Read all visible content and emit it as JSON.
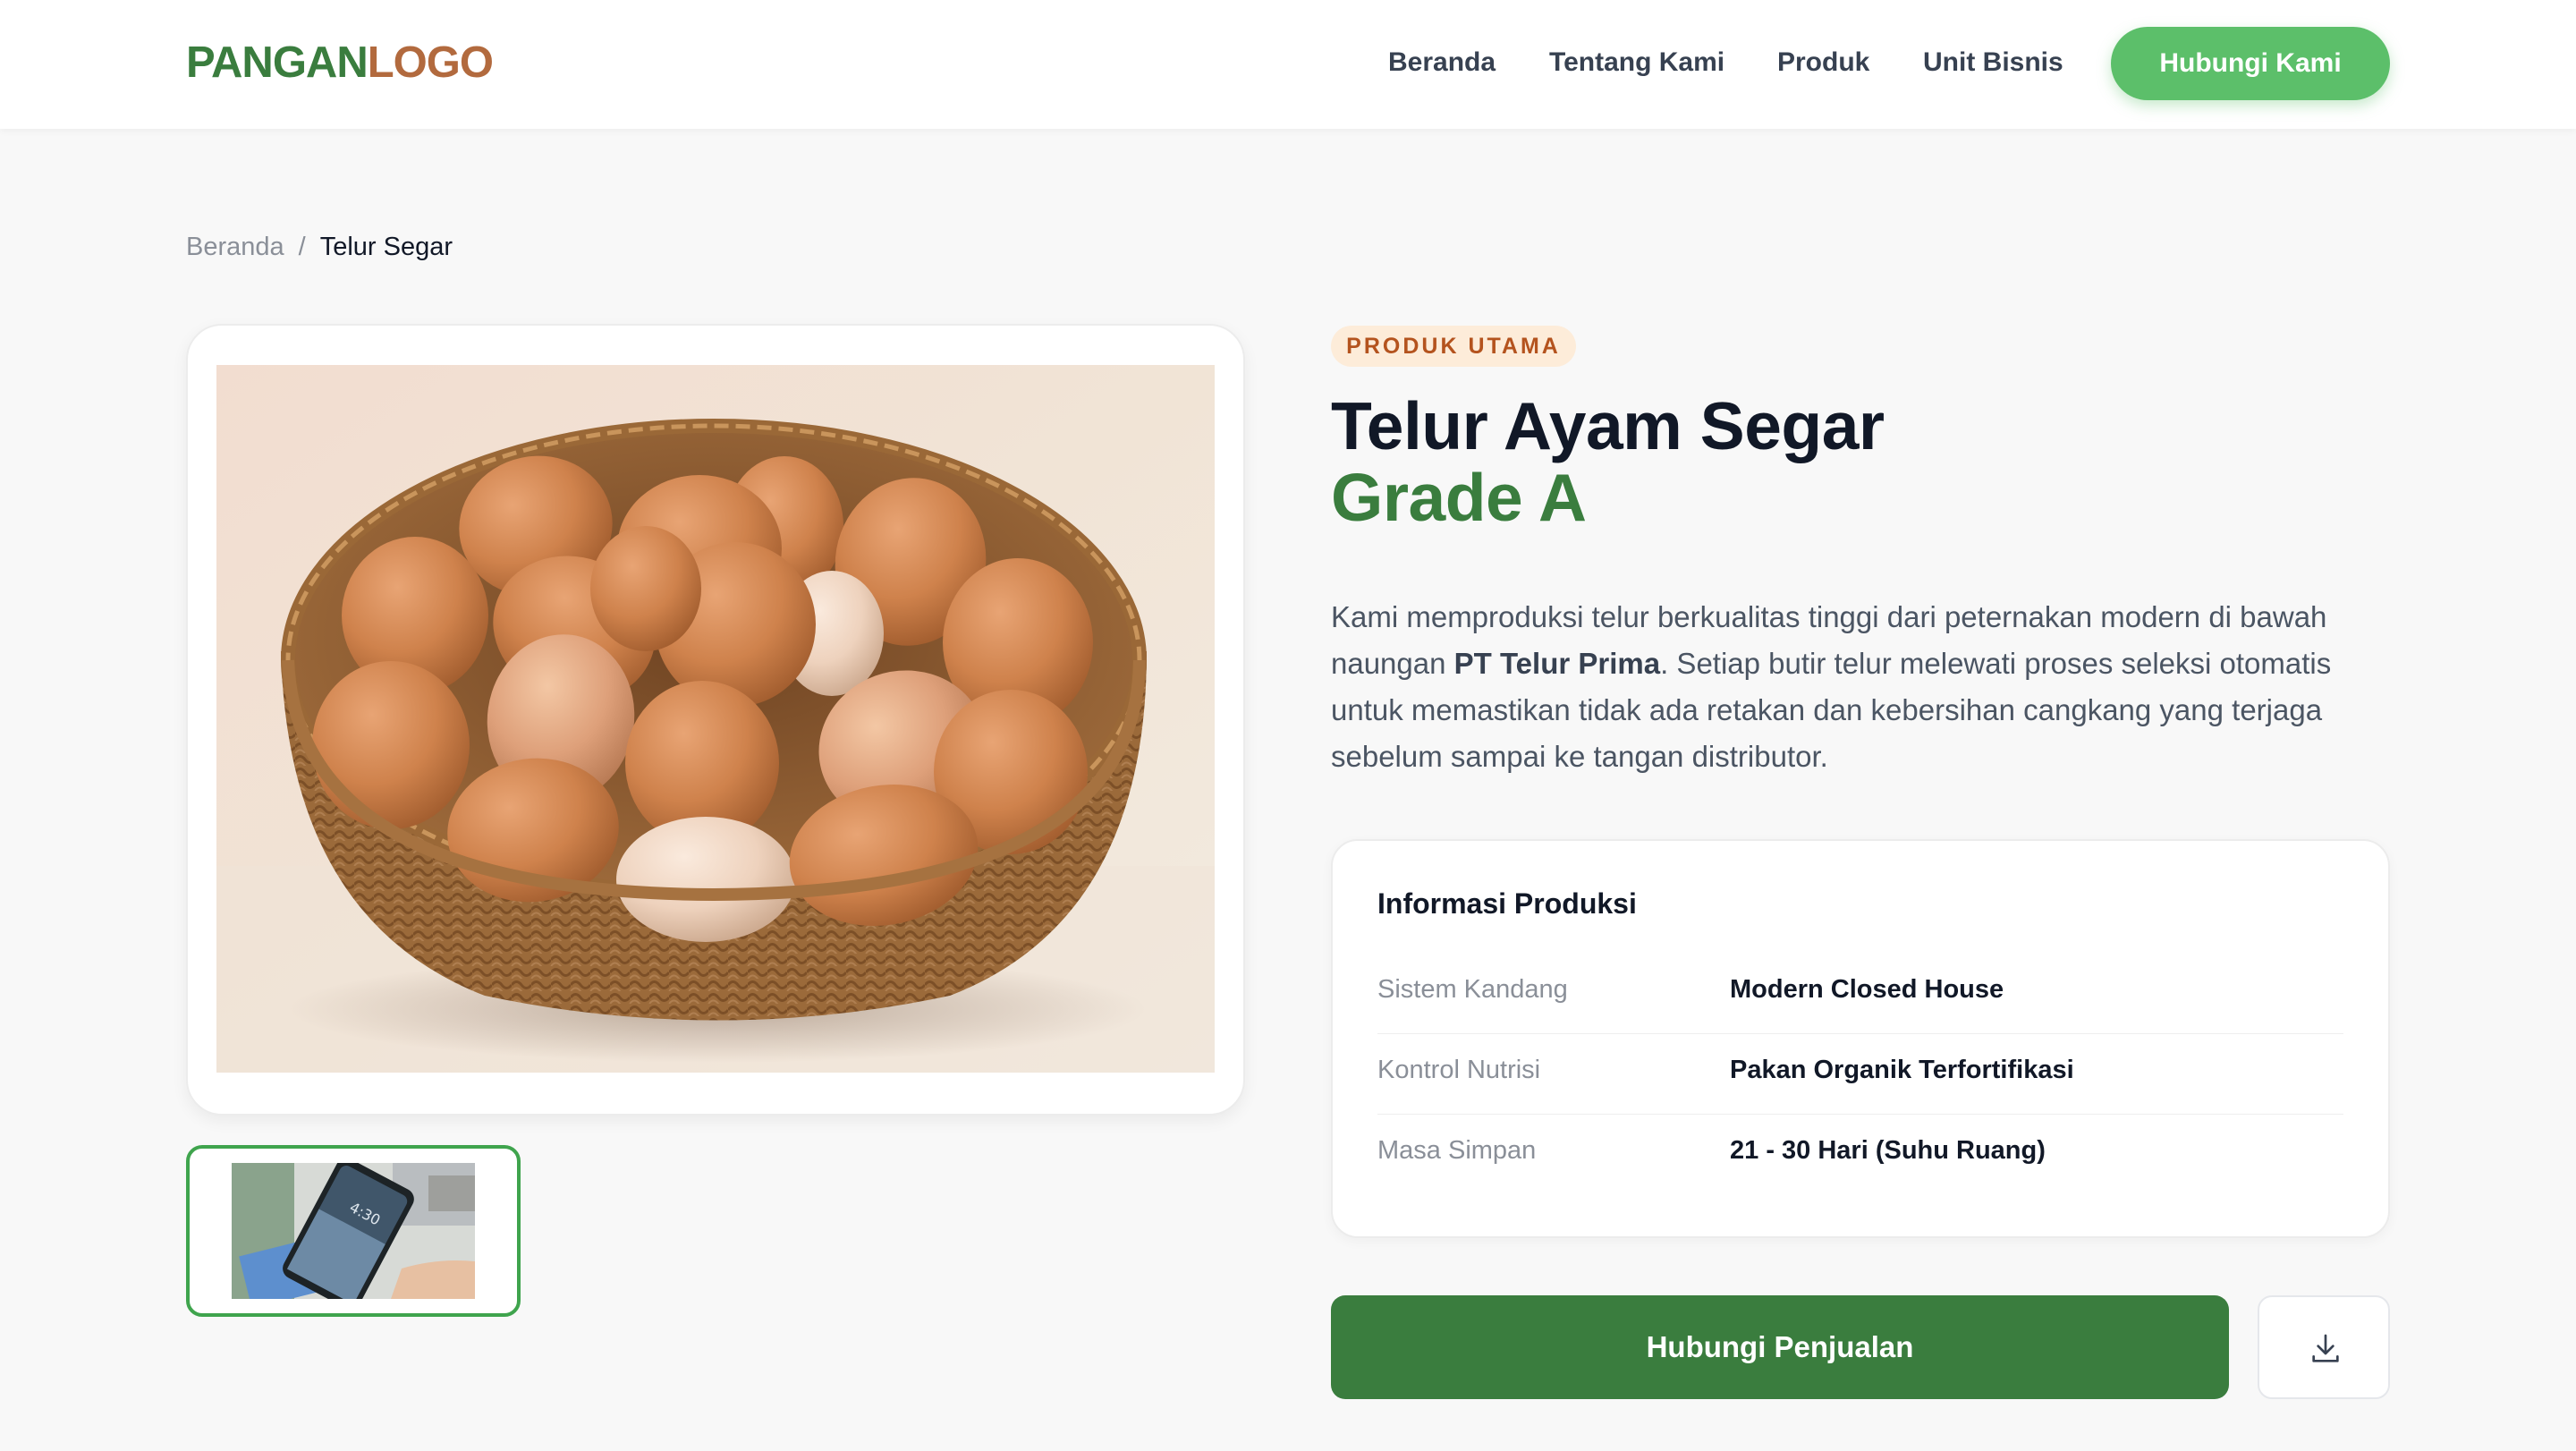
{
  "header": {
    "logo_part1": "PANGAN",
    "logo_part2": "LOGO",
    "nav": [
      "Beranda",
      "Tentang Kami",
      "Produk",
      "Unit Bisnis"
    ],
    "cta_label": "Hubungi Kami"
  },
  "breadcrumb": {
    "home": "Beranda",
    "separator": "/",
    "current": "Telur Segar"
  },
  "gallery": {
    "main_image_icon": "egg-basket-photo",
    "thumbnail_icon": "smartphone-photo",
    "thumbnail_clock": "4:30"
  },
  "product": {
    "badge": "PRODUK UTAMA",
    "title_line1": "Telur Ayam Segar",
    "title_line2": "Grade A",
    "desc_before": "Kami memproduksi telur berkualitas tinggi dari peternakan modern di bawah naungan ",
    "desc_bold": "PT Telur Prima",
    "desc_after": ". Setiap butir telur melewati proses seleksi otomatis untuk memastikan tidak ada retakan dan kebersihan cangkang yang terjaga sebelum sampai ke tangan distributor."
  },
  "spec": {
    "title": "Informasi Produksi",
    "rows": [
      {
        "label": "Sistem Kandang",
        "value": "Modern Closed House"
      },
      {
        "label": "Kontrol Nutrisi",
        "value": "Pakan Organik Terfortifikasi"
      },
      {
        "label": "Masa Simpan",
        "value": "21 - 30 Hari (Suhu Ruang)"
      }
    ]
  },
  "actions": {
    "primary_label": "Hubungi Penjualan",
    "download_icon": "download-icon"
  },
  "colors": {
    "brand_green": "#3a7d3e",
    "brand_brown": "#b26a3e",
    "cta_light_green": "#5cbf6a",
    "badge_bg": "#fdecd9",
    "badge_text": "#b4531e"
  }
}
